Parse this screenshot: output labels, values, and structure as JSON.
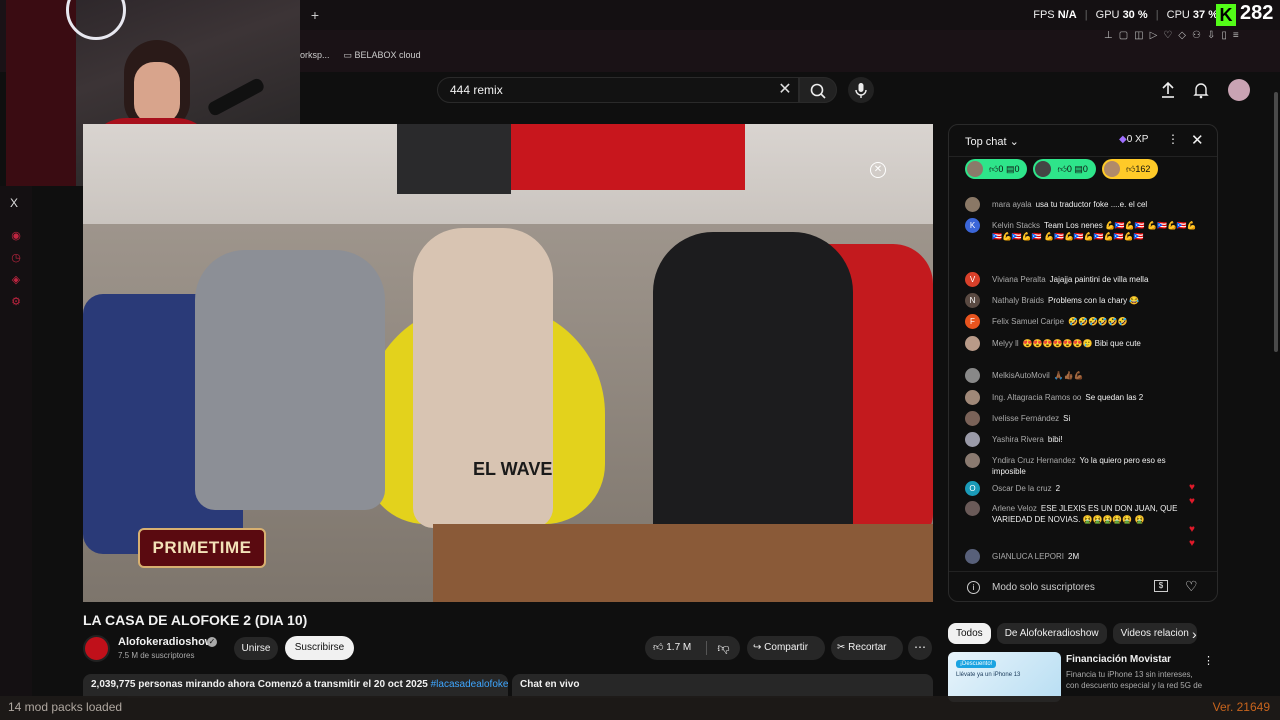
{
  "overlay": {
    "fps_label": "FPS",
    "fps_value": "N/A",
    "gpu_label": "GPU",
    "gpu_value": "30 %",
    "cpu_label": "CPU",
    "cpu_value": "37 %",
    "kick_letter": "K",
    "viewer_count": "282",
    "new_tab": "+"
  },
  "bookmarks": [
    "orksp...",
    "BELABOX cloud"
  ],
  "search": {
    "value": "444 remix"
  },
  "video": {
    "title": "LA CASA DE ALOFOKE 2 (DIA 10)",
    "overlay_logo": "PRIMETIME",
    "beanbag_text": "EL WAVE"
  },
  "channel": {
    "name": "Alofokeradioshow",
    "subscribers": "7.5 M de suscriptores",
    "join_label": "Unirse",
    "subscribe_label": "Suscribirse"
  },
  "actions": {
    "likes": "1.7 M",
    "share": "Compartir",
    "clip": "Recortar"
  },
  "description": {
    "viewers": "2,039,775 personas mirando ahora",
    "started": "Comenzó a transmitir el 20 oct 2025",
    "tags": "#lacasadealofoke #alo",
    "chat_live": "Chat en vivo"
  },
  "chat": {
    "mode": "Top chat",
    "xp": "0 XP",
    "tickers": [
      {
        "likes": "0",
        "comments": "0"
      },
      {
        "likes": "0",
        "comments": "0"
      },
      {
        "likes": "162",
        "comments": ""
      }
    ],
    "messages": [
      {
        "author": "mara ayala",
        "text": "usa tu traductor foke ....e. el cel",
        "avatar": ""
      },
      {
        "author": "Kelvin Stacks",
        "text": "Team Los nenes 💪🇵🇷💪🇵🇷 💪🇵🇷💪🇵🇷💪🇵🇷💪🇵🇷💪🇵🇷 💪🇵🇷💪🇵🇷💪🇵🇷💪🇵🇷💪🇵🇷",
        "avatar": "K"
      },
      {
        "author": "Viviana Peralta",
        "text": "Jajajja paintini de villa mella",
        "avatar": "V"
      },
      {
        "author": "Nathaly Braids",
        "text": "Problems con la chary 😂",
        "avatar": "N"
      },
      {
        "author": "Felix Samuel Caripe",
        "text": "🤣🤣🤣🤣🤣🤣",
        "avatar": "F"
      },
      {
        "author": "Melyy ll",
        "text": "😍😍😍😍😍😍🥲 Bibi que cute",
        "avatar": ""
      },
      {
        "author": "MelkisAutoMovil",
        "text": "🙏🏾👍🏾💪🏾",
        "avatar": ""
      },
      {
        "author": "Ing. Altagracia Ramos oo",
        "text": "Se quedan las 2",
        "avatar": ""
      },
      {
        "author": "Ivelisse Fernández",
        "text": "Si",
        "avatar": ""
      },
      {
        "author": "Yashira Rivera",
        "text": "bibi!",
        "avatar": ""
      },
      {
        "author": "Yndira Cruz Hernandez",
        "text": "Yo la quiero pero eso es imposible",
        "avatar": ""
      },
      {
        "author": "Oscar De la cruz",
        "text": "2",
        "avatar": "O"
      },
      {
        "author": "Arlene Veloz",
        "text": "ESE JLEXIS ES UN DON JUAN, QUE VARIEDAD DE NOVIAS. 🤮🤮🤮🤮🤮 🤮",
        "avatar": ""
      },
      {
        "author": "GIANLUCA LEPORI",
        "text": "2M",
        "avatar": ""
      }
    ],
    "footer_text": "Modo solo suscriptores"
  },
  "recommendations": {
    "chips": [
      "Todos",
      "De Alofokeradioshow",
      "Videos relacion"
    ],
    "item": {
      "title": "Financiación Movistar",
      "desc": "Financia tu iPhone 13 sin intereses, con descuento especial y la red 5G de",
      "thumb_badge": "¡Descuento!",
      "thumb_caption": "Llévate ya un iPhone 13"
    }
  },
  "status": {
    "left": "14 mod packs loaded",
    "right": "Ver. 21649"
  },
  "colors": {
    "accent_green": "#53fc18",
    "ticker_green": "#2ee58a",
    "subscribe_bg": "#f1f1f1",
    "link_blue": "#3ea6ff",
    "version_orange": "#d2691e"
  },
  "icons": [
    "x-icon",
    "search-icon",
    "mic-icon",
    "upload-icon",
    "bell-icon",
    "close-icon",
    "like-icon",
    "dislike-icon",
    "share-icon",
    "scissors-icon",
    "more-icon",
    "info-icon",
    "heart-icon",
    "chevron-right-icon"
  ]
}
